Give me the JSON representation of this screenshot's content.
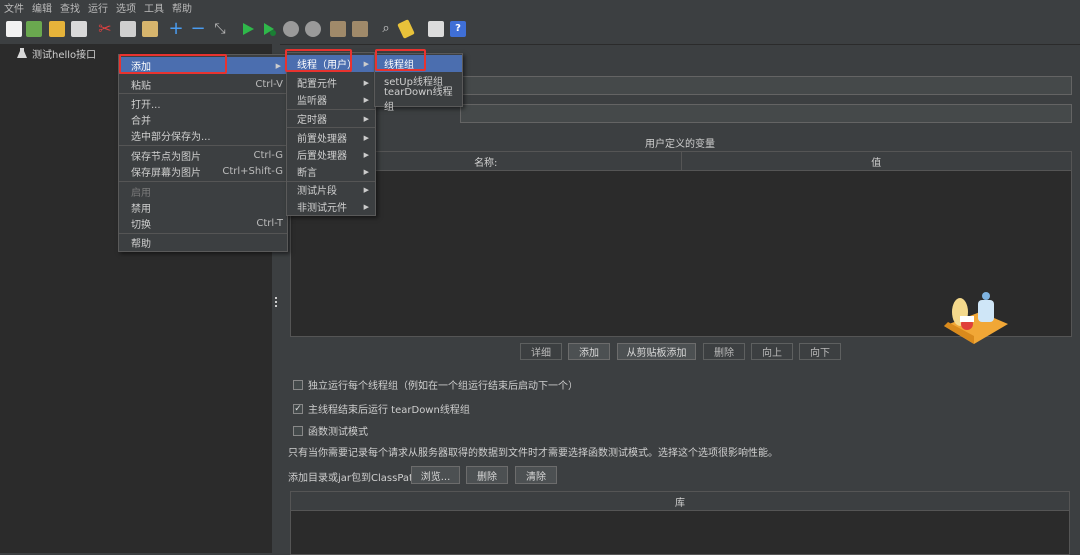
{
  "menubar": [
    "文件",
    "编辑",
    "查找",
    "运行",
    "选项",
    "工具",
    "帮助"
  ],
  "tree": {
    "root_label": "测试hello接口"
  },
  "context_menu": {
    "items": [
      {
        "label": "添加",
        "accel": "",
        "submenu": true
      },
      {
        "label": "粘贴",
        "accel": "Ctrl-V"
      },
      {
        "label": "打开...",
        "accel": ""
      },
      {
        "label": "合并",
        "accel": ""
      },
      {
        "label": "选中部分保存为...",
        "accel": ""
      },
      {
        "label": "保存节点为图片",
        "accel": "Ctrl-G"
      },
      {
        "label": "保存屏幕为图片",
        "accel": "Ctrl+Shift-G"
      },
      {
        "label": "启用",
        "accel": "",
        "disabled": true
      },
      {
        "label": "禁用",
        "accel": ""
      },
      {
        "label": "切换",
        "accel": "Ctrl-T"
      },
      {
        "label": "帮助",
        "accel": ""
      }
    ]
  },
  "add_submenu": {
    "items": [
      "线程（用户）",
      "配置元件",
      "监听器",
      "定时器",
      "前置处理器",
      "后置处理器",
      "断言",
      "测试片段",
      "非测试元件"
    ]
  },
  "thread_submenu": {
    "items": [
      "线程组",
      "setUp线程组",
      "tearDown线程组"
    ]
  },
  "variables": {
    "title": "用户定义的变量",
    "col_name": "名称:",
    "col_value": "值",
    "buttons": [
      "详细",
      "添加",
      "从剪贴板添加",
      "删除",
      "向上",
      "向下"
    ]
  },
  "options": {
    "independent": "独立运行每个线程组（例如在一个组运行结束后启动下一个）",
    "teardown": "主线程结束后运行 tearDown线程组",
    "functional": "函数测试模式",
    "note": "只有当你需要记录每个请求从服务器取得的数据到文件时才需要选择函数测试模式。选择这个选项很影响性能。"
  },
  "classpath": {
    "label": "添加目录或jar包到ClassPath",
    "browse": "浏览...",
    "delete": "删除",
    "clear": "清除",
    "lib_header": "库"
  },
  "colors": {
    "selection": "#4b6eaf",
    "highlight_box": "#e8332f",
    "background": "#3c3f41",
    "tree_bg": "#2b2b2b"
  }
}
